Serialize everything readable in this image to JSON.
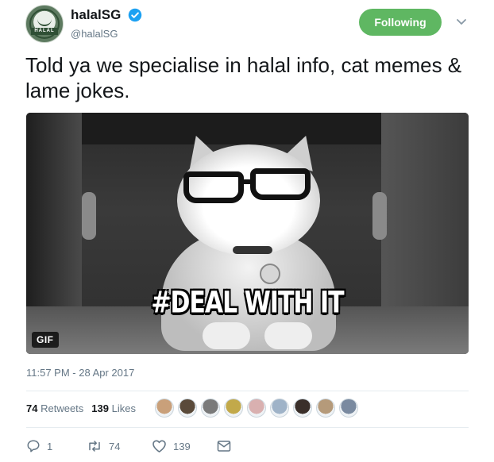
{
  "header": {
    "display_name": "halalSG",
    "handle": "@halalSG",
    "verified_icon": "verified-badge-icon",
    "avatar_text": "HALAL",
    "follow_label": "Following",
    "menu_icon": "chevron-down-icon"
  },
  "tweet": {
    "text": "Told ya we specialise in halal info, cat memes & lame jokes.",
    "media": {
      "overlay_text": "#DEAL WITH IT",
      "badge": "GIF"
    },
    "timestamp": "11:57 PM - 28 Apr 2017"
  },
  "stats": {
    "retweets_count": "74",
    "retweets_label": "Retweets",
    "likes_count": "139",
    "likes_label": "Likes"
  },
  "likers": [
    {
      "color": "#c9a07a"
    },
    {
      "color": "#5a4a3a"
    },
    {
      "color": "#7a7a7a"
    },
    {
      "color": "#c2a94a"
    },
    {
      "color": "#d9b0b0"
    },
    {
      "color": "#9fb3c8"
    },
    {
      "color": "#3a2f2a"
    },
    {
      "color": "#b59a7a"
    },
    {
      "color": "#7a8aa0"
    }
  ],
  "actions": {
    "reply_icon": "reply-icon",
    "reply_count": "1",
    "retweet_icon": "retweet-icon",
    "retweet_count": "74",
    "like_icon": "heart-icon",
    "like_count": "139",
    "dm_icon": "envelope-icon"
  },
  "colors": {
    "follow_green": "#5fb762",
    "verified_blue": "#1da1f2",
    "muted": "#657786"
  }
}
